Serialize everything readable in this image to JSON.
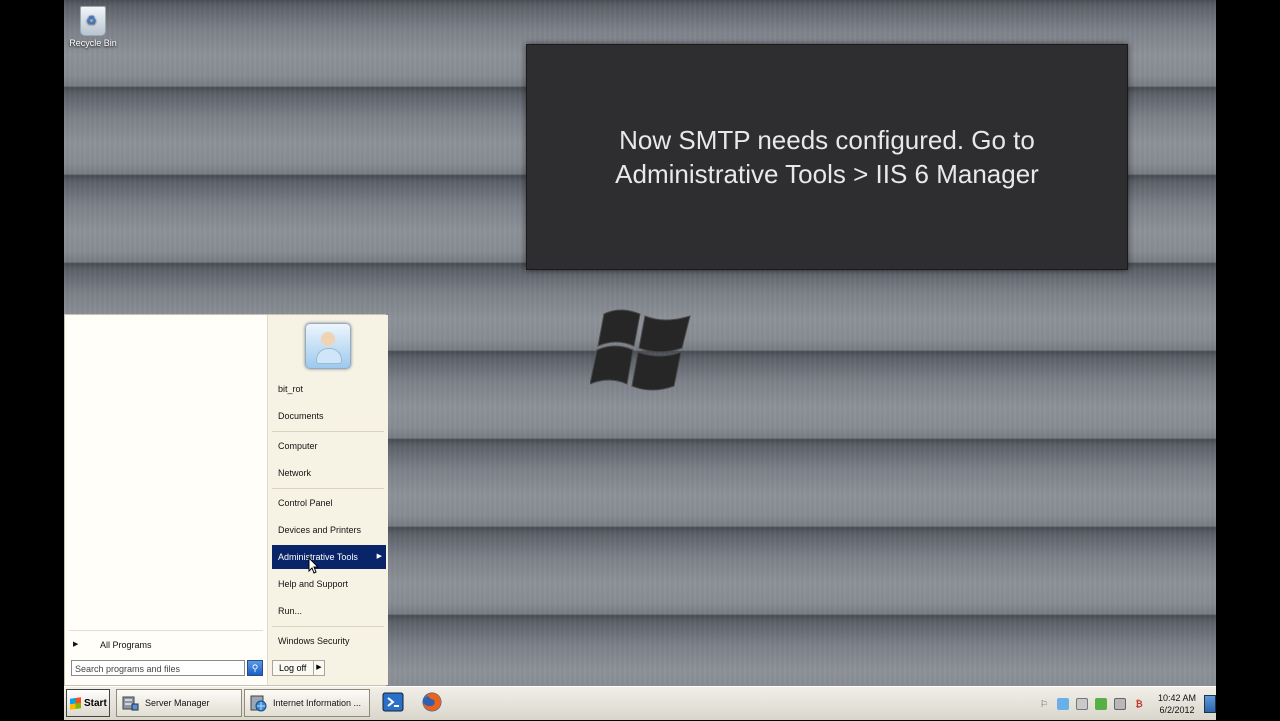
{
  "desktop": {
    "recycle_bin_label": "Recycle Bin",
    "caption_line1": "Now SMTP needs configured. Go to",
    "caption_line2": "Administrative Tools > IIS 6 Manager"
  },
  "start_menu": {
    "right_items": [
      {
        "label": "bit_rot"
      },
      {
        "label": "Documents"
      },
      {
        "label": "Computer"
      },
      {
        "label": "Network"
      },
      {
        "label": "Control Panel"
      },
      {
        "label": "Devices and Printers"
      },
      {
        "label": "Administrative Tools"
      },
      {
        "label": "Help and Support"
      },
      {
        "label": "Run..."
      },
      {
        "label": "Windows Security"
      }
    ],
    "all_programs": "All Programs",
    "search_placeholder": "Search programs and files",
    "log_off": "Log off"
  },
  "taskbar": {
    "start_label": "Start",
    "tasks": [
      {
        "label": "Server Manager",
        "icon": "server-manager-icon"
      },
      {
        "label": "Internet Information ...",
        "icon": "iis-icon"
      }
    ],
    "quick_launch": [
      "powershell-icon",
      "firefox-icon"
    ],
    "clock_time": "10:42 AM",
    "clock_date": "6/2/2012"
  },
  "colors": {
    "active_menu": "#0a246a",
    "caption_bg": "#2e2e30"
  }
}
